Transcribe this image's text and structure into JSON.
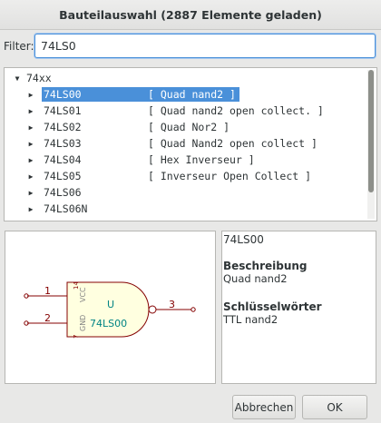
{
  "window": {
    "title": "Bauteilauswahl (2887 Elemente geladen)"
  },
  "filter": {
    "label": "Filter:",
    "value": "74LS0"
  },
  "tree": {
    "group": {
      "label": "74xx",
      "expanded": true
    },
    "items": [
      {
        "name": "74LS00",
        "desc": "[ Quad nand2 ]",
        "selected": true
      },
      {
        "name": "74LS01",
        "desc": "[ Quad nand2 open collect. ]",
        "selected": false
      },
      {
        "name": "74LS02",
        "desc": "[ Quad Nor2 ]",
        "selected": false
      },
      {
        "name": "74LS03",
        "desc": "[ Quad Nand2 open collect ]",
        "selected": false
      },
      {
        "name": "74LS04",
        "desc": "[ Hex Inverseur ]",
        "selected": false
      },
      {
        "name": "74LS05",
        "desc": "[ Inverseur Open Collect ]",
        "selected": false
      },
      {
        "name": "74LS06",
        "desc": "",
        "selected": false
      },
      {
        "name": "74LS06N",
        "desc": "",
        "selected": false
      }
    ]
  },
  "preview": {
    "ref": "U",
    "value": "74LS00",
    "pins": {
      "in1": "1",
      "in2": "2",
      "out": "3",
      "vcc_num": "14",
      "vcc": "VCC",
      "gnd_num": "7",
      "gnd": "GND"
    },
    "colors": {
      "body": "#840000",
      "pin": "#840000",
      "text": "#008484",
      "pin_name": "#848484"
    }
  },
  "info": {
    "part_name": "74LS00",
    "description_heading": "Beschreibung",
    "description": "Quad nand2",
    "keywords_heading": "Schlüsselwörter",
    "keywords": "TTL nand2"
  },
  "buttons": {
    "cancel": "Abbrechen",
    "ok": "OK"
  },
  "theme": {
    "accent": "#4a90d9"
  }
}
